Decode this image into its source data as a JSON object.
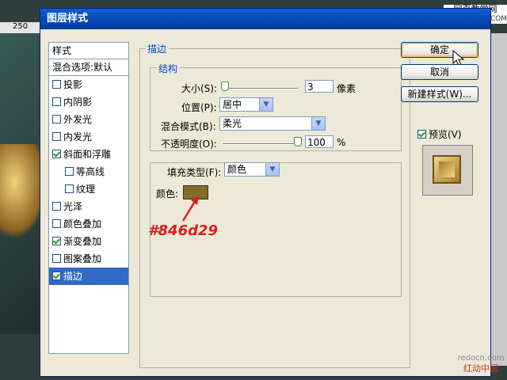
{
  "background": {
    "ruler_mark": "250",
    "watermark_top_line1": "网页教学网",
    "watermark_top_line2": "WWW.Webjx.COM",
    "watermark_bottom_url": "redocn.com",
    "watermark_bottom_text": "红动中国"
  },
  "dialog": {
    "title": "图层样式"
  },
  "styles_panel": {
    "header": "样式",
    "blend_options": "混合选项:默认",
    "items": [
      {
        "label": "投影",
        "checked": false,
        "sub": false,
        "selected": false
      },
      {
        "label": "内阴影",
        "checked": false,
        "sub": false,
        "selected": false
      },
      {
        "label": "外发光",
        "checked": false,
        "sub": false,
        "selected": false
      },
      {
        "label": "内发光",
        "checked": false,
        "sub": false,
        "selected": false
      },
      {
        "label": "斜面和浮雕",
        "checked": true,
        "sub": false,
        "selected": false
      },
      {
        "label": "等高线",
        "checked": false,
        "sub": true,
        "selected": false
      },
      {
        "label": "纹理",
        "checked": false,
        "sub": true,
        "selected": false
      },
      {
        "label": "光泽",
        "checked": false,
        "sub": false,
        "selected": false
      },
      {
        "label": "颜色叠加",
        "checked": false,
        "sub": false,
        "selected": false
      },
      {
        "label": "渐变叠加",
        "checked": true,
        "sub": false,
        "selected": false
      },
      {
        "label": "图案叠加",
        "checked": false,
        "sub": false,
        "selected": false
      },
      {
        "label": "描边",
        "checked": true,
        "sub": false,
        "selected": true
      }
    ]
  },
  "stroke": {
    "group_title": "描边",
    "structure_title": "结构",
    "size_label": "大小(S):",
    "size_value": "3",
    "size_unit": "像素",
    "position_label": "位置(P):",
    "position_value": "居中",
    "blend_mode_label": "混合模式(B):",
    "blend_mode_value": "柔光",
    "opacity_label": "不透明度(O):",
    "opacity_value": "100",
    "opacity_unit": "%",
    "fill_type_label": "填充类型(F):",
    "fill_type_value": "颜色",
    "color_label": "颜色:",
    "color_hex": "#846d29",
    "annotation": "#846d29"
  },
  "buttons": {
    "ok": "确定",
    "cancel": "取消",
    "new_style": "新建样式(W)...",
    "preview_label": "预览(V)",
    "preview_checked": true
  },
  "colors": {
    "selected_bg": "#316ac5",
    "annotation": "#d81e1e",
    "stroke_color": "#846d29"
  }
}
